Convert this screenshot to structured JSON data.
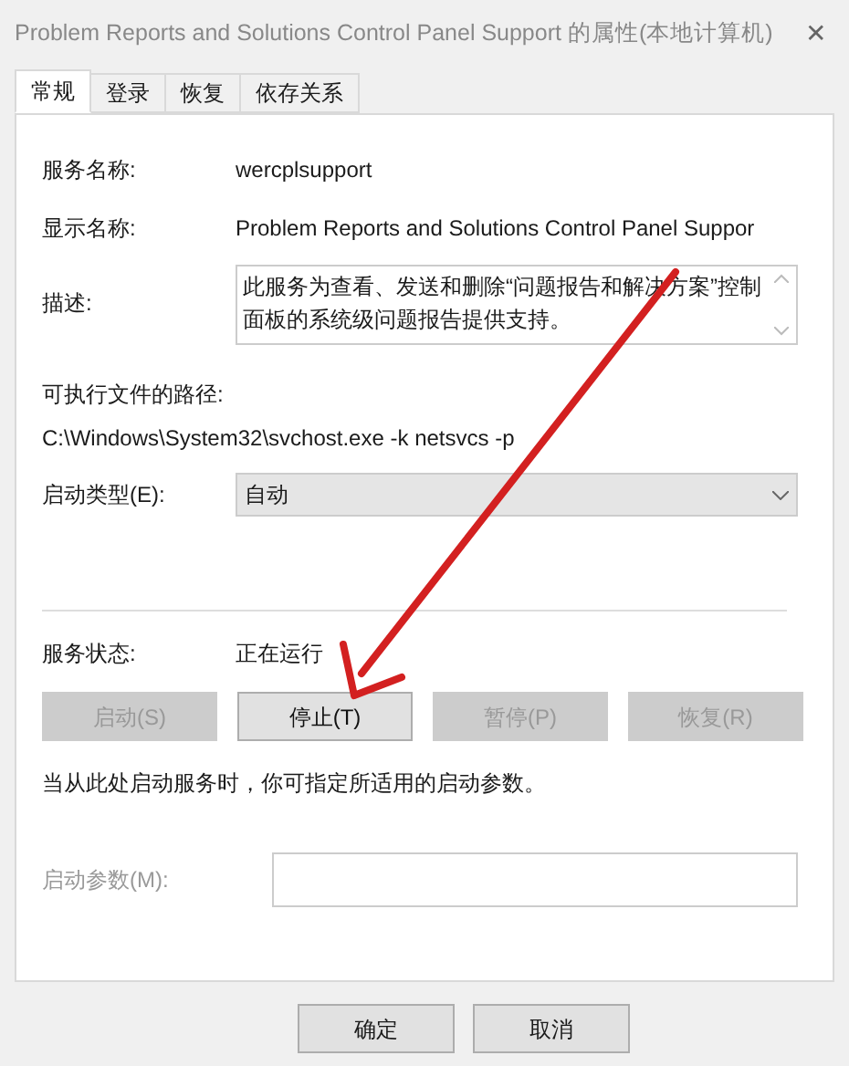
{
  "window": {
    "title": "Problem Reports and Solutions Control Panel Support 的属性(本地计算机)",
    "close": "✕"
  },
  "tabs": [
    {
      "label": "常规",
      "selected": true
    },
    {
      "label": "登录",
      "selected": false
    },
    {
      "label": "恢复",
      "selected": false
    },
    {
      "label": "依存关系",
      "selected": false
    }
  ],
  "general": {
    "service_name": {
      "label": "服务名称:",
      "value": "wercplsupport"
    },
    "display_name": {
      "label": "显示名称:",
      "value": "Problem Reports and Solutions Control Panel Suppor"
    },
    "description": {
      "label": "描述:",
      "value": "此服务为查看、发送和删除“问题报告和解决方案”控制面板的系统级问题报告提供支持。"
    },
    "path": {
      "label": "可执行文件的路径:",
      "value": "C:\\Windows\\System32\\svchost.exe -k netsvcs -p"
    },
    "startup_type": {
      "label": "启动类型(E):",
      "value": "自动"
    },
    "status": {
      "label": "服务状态:",
      "value": "正在运行"
    },
    "service_buttons": [
      {
        "label": "启动(S)",
        "disabled": true
      },
      {
        "label": "停止(T)",
        "disabled": false
      },
      {
        "label": "暂停(P)",
        "disabled": true
      },
      {
        "label": "恢复(R)",
        "disabled": true
      }
    ],
    "note": "当从此处启动服务时，你可指定所适用的启动参数。",
    "start_params": {
      "label": "启动参数(M):",
      "disabled": true
    }
  },
  "dialog_buttons": [
    {
      "label": "确定"
    },
    {
      "label": "取消"
    }
  ]
}
